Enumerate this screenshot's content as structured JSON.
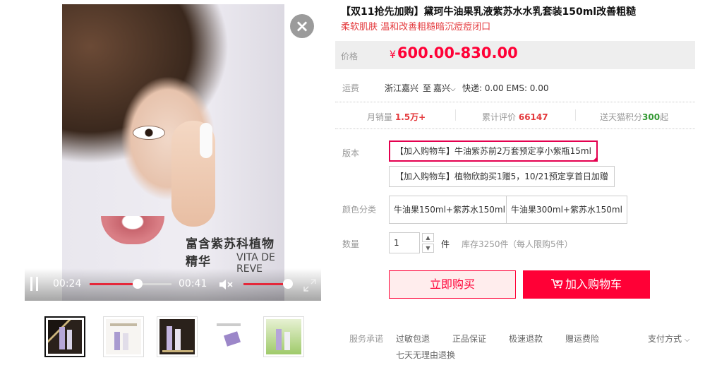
{
  "video": {
    "caption_cn": "富含紫苏科植物精华",
    "caption_en": "VITA DE REVE",
    "current_time": "00:24",
    "total_time": "00:41",
    "progress": 0.59,
    "volume": 0.9,
    "icons": [
      "pause-icon",
      "mute-icon",
      "fullscreen-icon",
      "close-icon"
    ]
  },
  "product": {
    "title": "【双11抢先加购】黛珂牛油果乳液紫苏水水乳套装150ml改善粗糙",
    "subtitle": "柔软肌肤 温和改善粗糙暗沉痘痘闭口"
  },
  "price": {
    "label": "价格",
    "currency": "¥",
    "value": "600.00-830.00"
  },
  "shipping": {
    "label": "运费",
    "from": "浙江嘉兴",
    "to_word": "至",
    "to": "嘉兴",
    "detail": "快递: 0.00 EMS: 0.00"
  },
  "stats": {
    "monthly_sales_label": "月销量",
    "monthly_sales": "1.5万+",
    "reviews_label": "累计评价",
    "reviews": "66147",
    "points_label": "送天猫积分",
    "points": "300",
    "points_suffix": "起"
  },
  "options": {
    "version_label": "版本",
    "versions": [
      "【加入购物车】牛油紫苏前2万套预定享小紫瓶15ml",
      "【加入购物车】植物欣韵买1赠5，10/21预定享首日加赠"
    ],
    "color_label": "颜色分类",
    "colors": [
      "牛油果150ml+紫苏水150ml",
      "牛油果300ml+紫苏水150ml"
    ],
    "qty_label": "数量",
    "qty_value": "1",
    "qty_unit": "件",
    "stock": "库存3250件",
    "limit": "（每人限购5件）"
  },
  "actions": {
    "buy_now": "立即购买",
    "add_to_cart": "加入购物车"
  },
  "services": {
    "label": "服务承诺",
    "items": [
      "过敏包退",
      "正品保证",
      "极速退款",
      "赠运费险"
    ],
    "extra": "七天无理由退换",
    "payment": "支付方式"
  },
  "colors": {
    "accent": "#ff0036",
    "selected_border": "#e4004f",
    "green": "#339933"
  }
}
